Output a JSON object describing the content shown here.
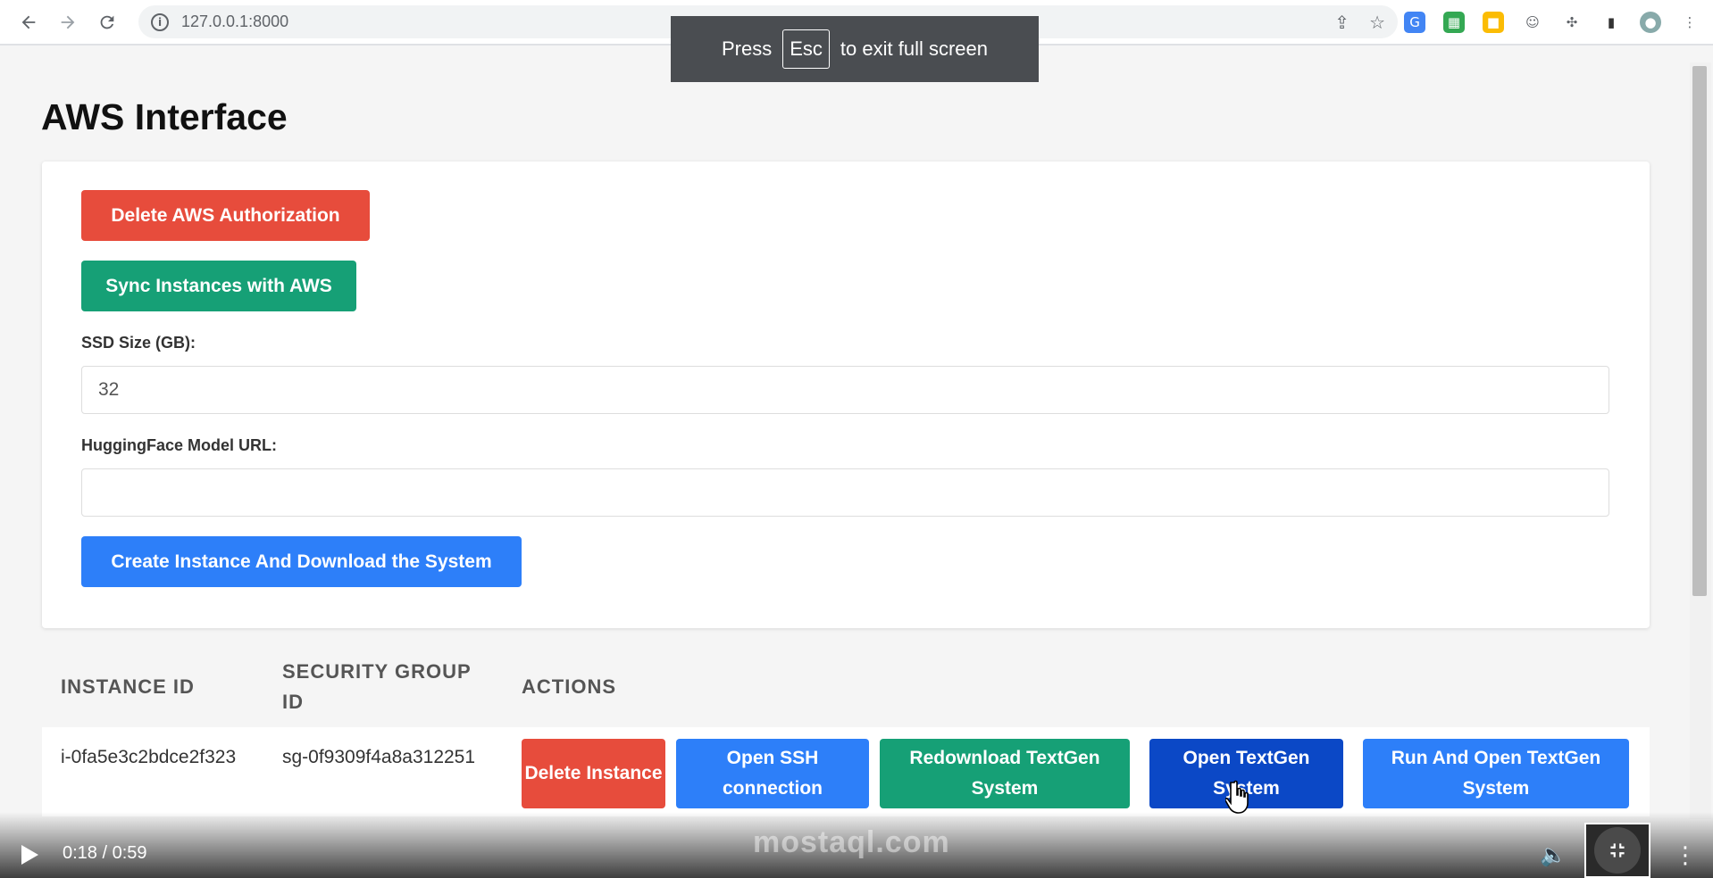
{
  "browser": {
    "url": "127.0.0.1:8000"
  },
  "fullscreen_notice": {
    "prefix": "Press",
    "key": "Esc",
    "suffix": "to exit full screen"
  },
  "page": {
    "title": "AWS Interface"
  },
  "controls": {
    "delete_auth_label": "Delete AWS Authorization",
    "sync_label": "Sync Instances with AWS",
    "ssd_label": "SSD Size (GB):",
    "ssd_value": "32",
    "hf_label": "HuggingFace Model URL:",
    "hf_value": "",
    "create_label": "Create Instance And Download the System"
  },
  "table": {
    "headers": [
      "INSTANCE ID",
      "SECURITY GROUP ID",
      "ACTIONS"
    ],
    "rows": [
      {
        "instance_id": "i-0fa5e3c2bdce2f323",
        "security_group_id": "sg-0f9309f4a8a312251",
        "actions": {
          "delete": "Delete Instance",
          "ssh": "Open SSH connection",
          "redownload": "Redownload TextGen System",
          "open": "Open TextGen System",
          "run_open": "Run And Open TextGen System"
        }
      }
    ]
  },
  "video": {
    "time": "0:18 / 0:59",
    "watermark": "mostaql.com"
  },
  "colors": {
    "red": "#e74c3c",
    "green": "#16a076",
    "blue": "#2d7ff9",
    "dark_blue": "#0b48c6"
  }
}
